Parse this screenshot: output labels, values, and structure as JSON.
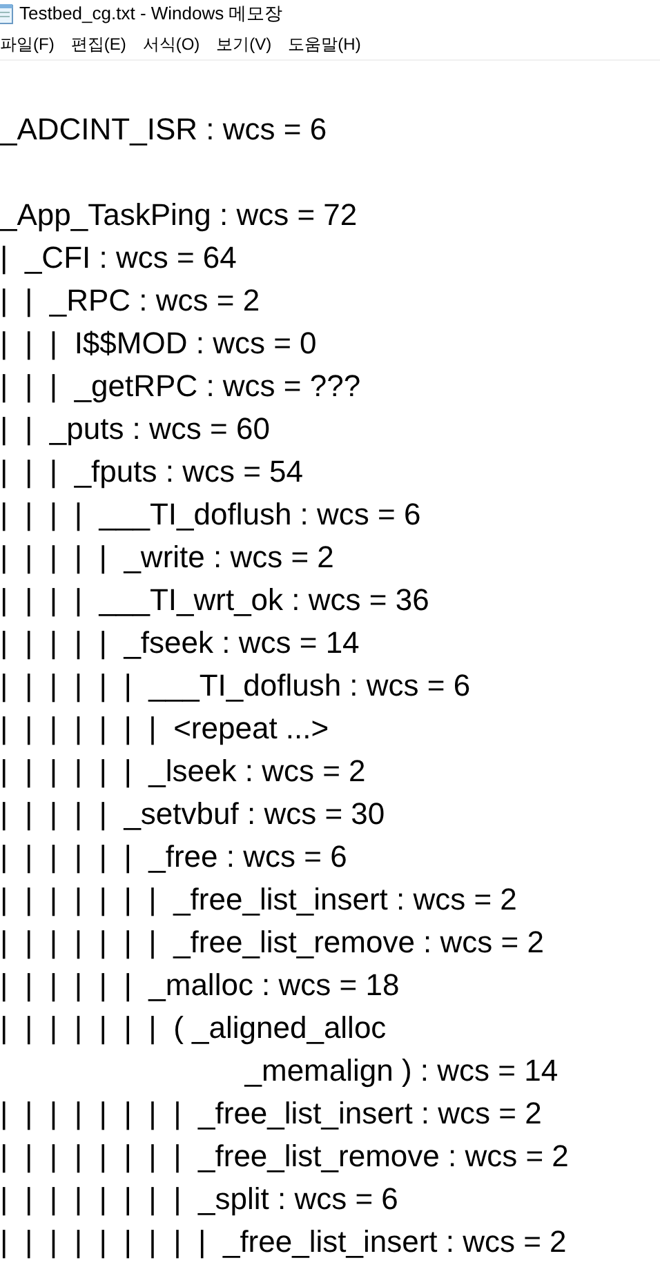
{
  "window": {
    "title": "Testbed_cg.txt - Windows 메모장"
  },
  "menu": [
    "파일(F)",
    "편집(E)",
    "서식(O)",
    "보기(V)",
    "도움말(H)"
  ],
  "document": {
    "paragraphs": [
      [
        "_ADCINT_ISR : wcs = 6"
      ],
      [
        "_App_TaskPing : wcs = 72",
        "|  _CFI : wcs = 64",
        "|  |  _RPC : wcs = 2",
        "|  |  |  I$$MOD : wcs = 0",
        "|  |  |  _getRPC : wcs = ???",
        "|  |  _puts : wcs = 60",
        "|  |  |  _fputs : wcs = 54",
        "|  |  |  |  ___TI_doflush : wcs = 6",
        "|  |  |  |  |  _write : wcs = 2",
        "|  |  |  |  ___TI_wrt_ok : wcs = 36",
        "|  |  |  |  |  _fseek : wcs = 14",
        "|  |  |  |  |  |  ___TI_doflush : wcs = 6",
        "|  |  |  |  |  |  |  <repeat ...>",
        "|  |  |  |  |  |  _lseek : wcs = 2",
        "|  |  |  |  |  _setvbuf : wcs = 30",
        "|  |  |  |  |  |  _free : wcs = 6",
        "|  |  |  |  |  |  |  _free_list_insert : wcs = 2",
        "|  |  |  |  |  |  |  _free_list_remove : wcs = 2",
        "|  |  |  |  |  |  _malloc : wcs = 18",
        "|  |  |  |  |  |  |  ( _aligned_alloc",
        "                             _memalign ) : wcs = 14",
        "|  |  |  |  |  |  |  |  _free_list_insert : wcs = 2",
        "|  |  |  |  |  |  |  |  _free_list_remove : wcs = 2",
        "|  |  |  |  |  |  |  |  _split : wcs = 6",
        "|  |  |  |  |  |  |  |  |  _free_list_insert : wcs = 2"
      ]
    ]
  }
}
